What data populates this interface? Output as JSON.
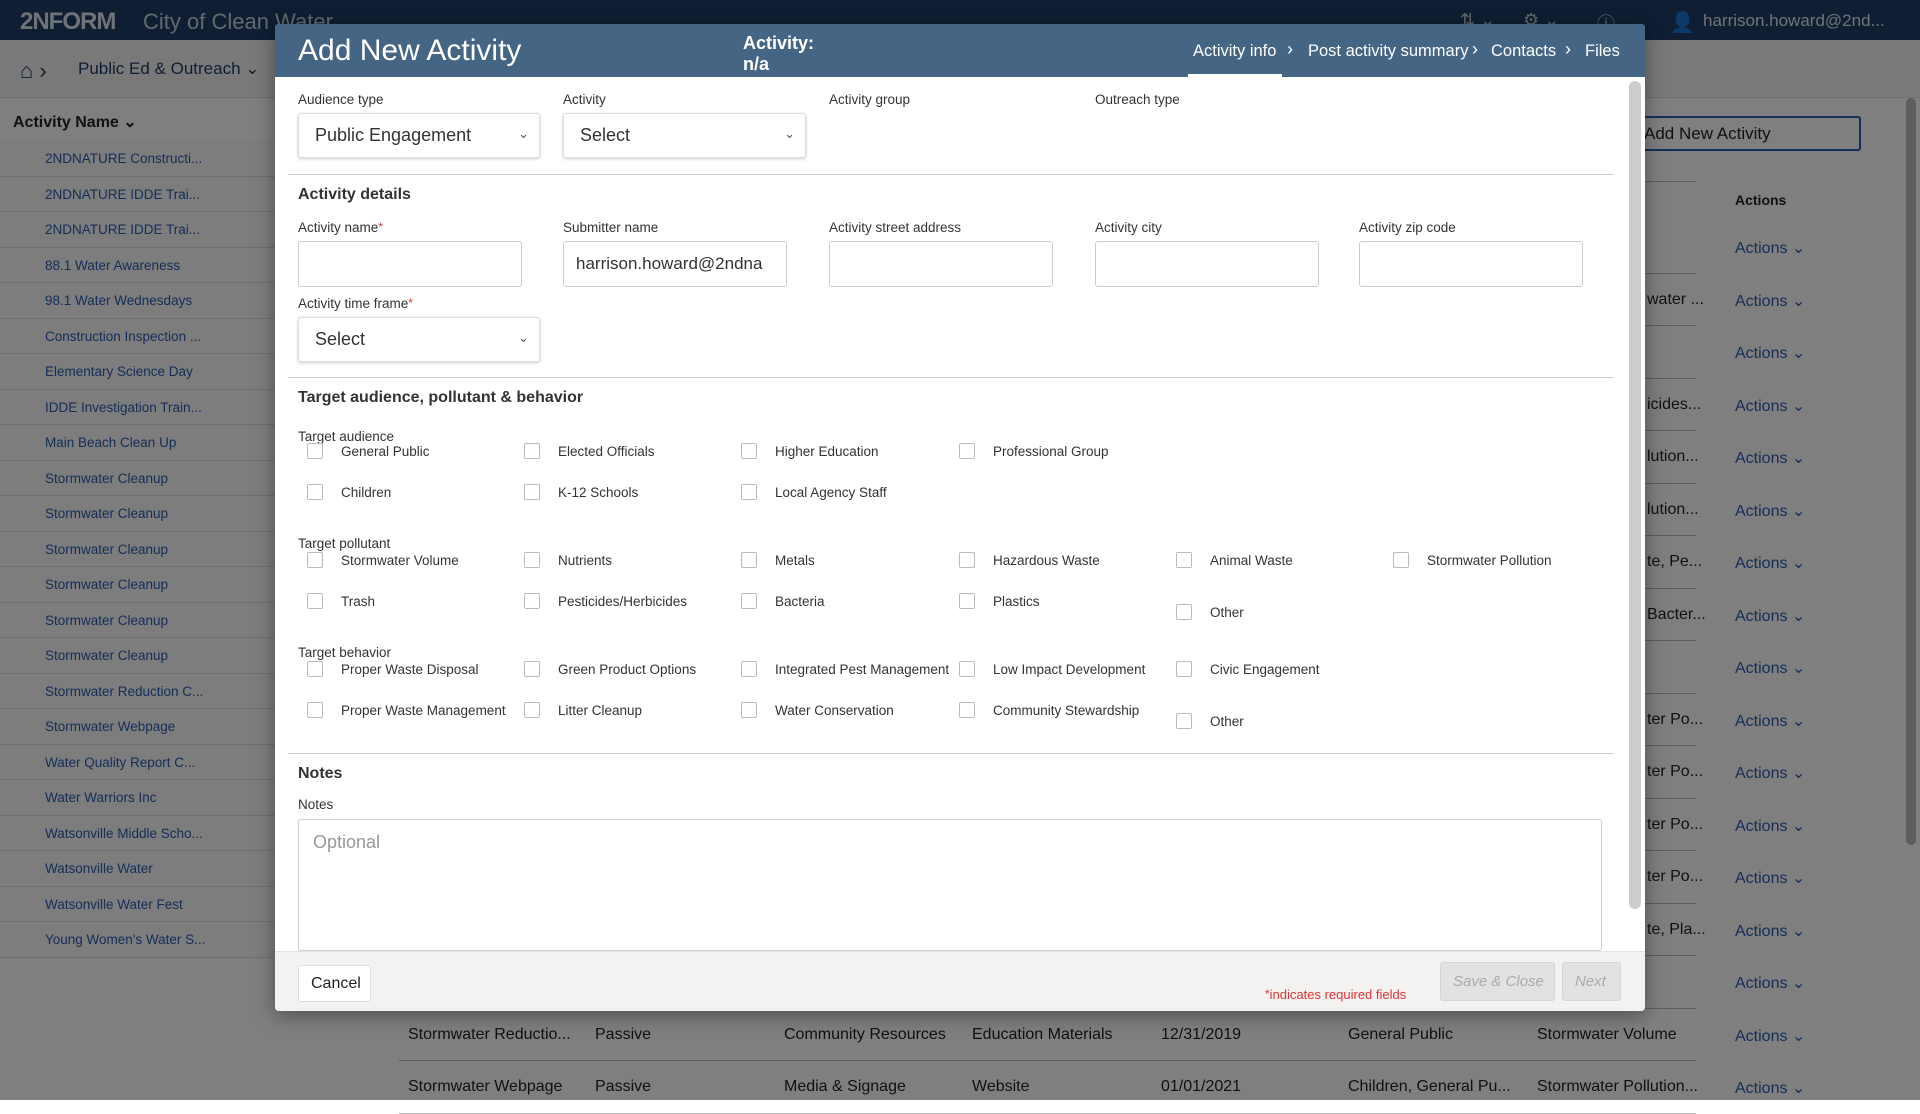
{
  "app": {
    "logo": "2NFORM",
    "org": "City of Clean Water",
    "user": "harrison.howard@2nd...",
    "icons": [
      "upload-icon",
      "gear-icon",
      "help-icon",
      "user-icon"
    ]
  },
  "subbar": {
    "breadcrumb": "Public Ed & Outreach"
  },
  "list": {
    "header": "Activity Name",
    "items": [
      "2NDNATURE Constructi...",
      "2NDNATURE IDDE Trai...",
      "2NDNATURE IDDE Trai...",
      "88.1 Water Awareness",
      "98.1 Water Wednesdays",
      "Construction Inspection ...",
      "Elementary Science Day",
      "IDDE Investigation Train...",
      "Main Beach Clean Up",
      "Stormwater Cleanup",
      "Stormwater Cleanup",
      "Stormwater Cleanup",
      "Stormwater Cleanup",
      "Stormwater Cleanup",
      "Stormwater Cleanup",
      "Stormwater Reduction C...",
      "Stormwater Webpage",
      "Water Quality Report C...",
      "Water Warriors Inc",
      "Watsonville Middle Scho...",
      "Watsonville Water",
      "Watsonville Water Fest",
      "Young Women's Water S..."
    ]
  },
  "table": {
    "add_button": "Add New Activity",
    "actions_header": "Actions",
    "action_label": "Actions",
    "partial_rows": [
      "",
      "water ...",
      "",
      "icides...",
      "lution...",
      "lution...",
      "te, Pe...",
      "Bacter...",
      "",
      "ter Po...",
      "ter Po...",
      "ter Po...",
      "ter Po...",
      "te, Pla...",
      ""
    ],
    "rows": [
      [
        "Stormwater Reductio...",
        "Passive",
        "Community Resources",
        "Education Materials",
        "12/31/2019",
        "General Public",
        "Stormwater Volume"
      ],
      [
        "Stormwater Webpage",
        "Passive",
        "Media & Signage",
        "Website",
        "01/01/2021",
        "Children, General Pu...",
        "Stormwater Pollution..."
      ]
    ]
  },
  "modal": {
    "title": "Add New Activity",
    "activity_label": "Activity:",
    "activity_value": "n/a",
    "steps": [
      "Activity info",
      "Post activity summary",
      "Contacts",
      "Files"
    ],
    "active_step": "Activity info",
    "audience_type": {
      "label": "Audience type",
      "value": "Public Engagement"
    },
    "activity": {
      "label": "Activity",
      "value": "Select"
    },
    "activity_group": {
      "label": "Activity group"
    },
    "outreach_type": {
      "label": "Outreach type"
    },
    "details": {
      "heading": "Activity details",
      "name_label": "Activity name",
      "name_value": "",
      "submitter_label": "Submitter name",
      "submitter_value": "harrison.howard@2ndna",
      "street_label": "Activity street address",
      "city_label": "Activity city",
      "zip_label": "Activity zip code",
      "timeframe_label": "Activity time frame",
      "timeframe_value": "Select",
      "required_mark": "*"
    },
    "target": {
      "heading": "Target audience, pollutant & behavior",
      "audience": {
        "label": "Target audience",
        "rows": [
          [
            "General Public",
            "Elected Officials",
            "Higher Education",
            "Professional Group"
          ],
          [
            "Children",
            "K-12 Schools",
            "Local Agency Staff"
          ]
        ]
      },
      "pollutant": {
        "label": "Target pollutant",
        "rows": [
          [
            "Stormwater Volume",
            "Nutrients",
            "Metals",
            "Hazardous Waste",
            "Animal Waste",
            "Stormwater Pollution"
          ],
          [
            "Trash",
            "Pesticides/Herbicides",
            "Bacteria",
            "Plastics",
            "Other"
          ]
        ]
      },
      "behavior": {
        "label": "Target behavior",
        "rows": [
          [
            "Proper Waste Disposal",
            "Green Product Options",
            "Integrated Pest Management",
            "Low Impact Development",
            "Civic Engagement"
          ],
          [
            "Proper Waste Management",
            "Litter Cleanup",
            "Water Conservation",
            "Community Stewardship",
            "Other"
          ]
        ]
      }
    },
    "notes": {
      "heading": "Notes",
      "label": "Notes",
      "placeholder": "Optional"
    },
    "footer": {
      "cancel": "Cancel",
      "required_note": "indicates required fields",
      "required_mark": "*",
      "save_close": "Save & Close",
      "next": "Next"
    }
  },
  "colors": {
    "header": "#456585",
    "topbar": "#1e3c66",
    "link": "#2a5db0",
    "required": "#dd3333"
  }
}
